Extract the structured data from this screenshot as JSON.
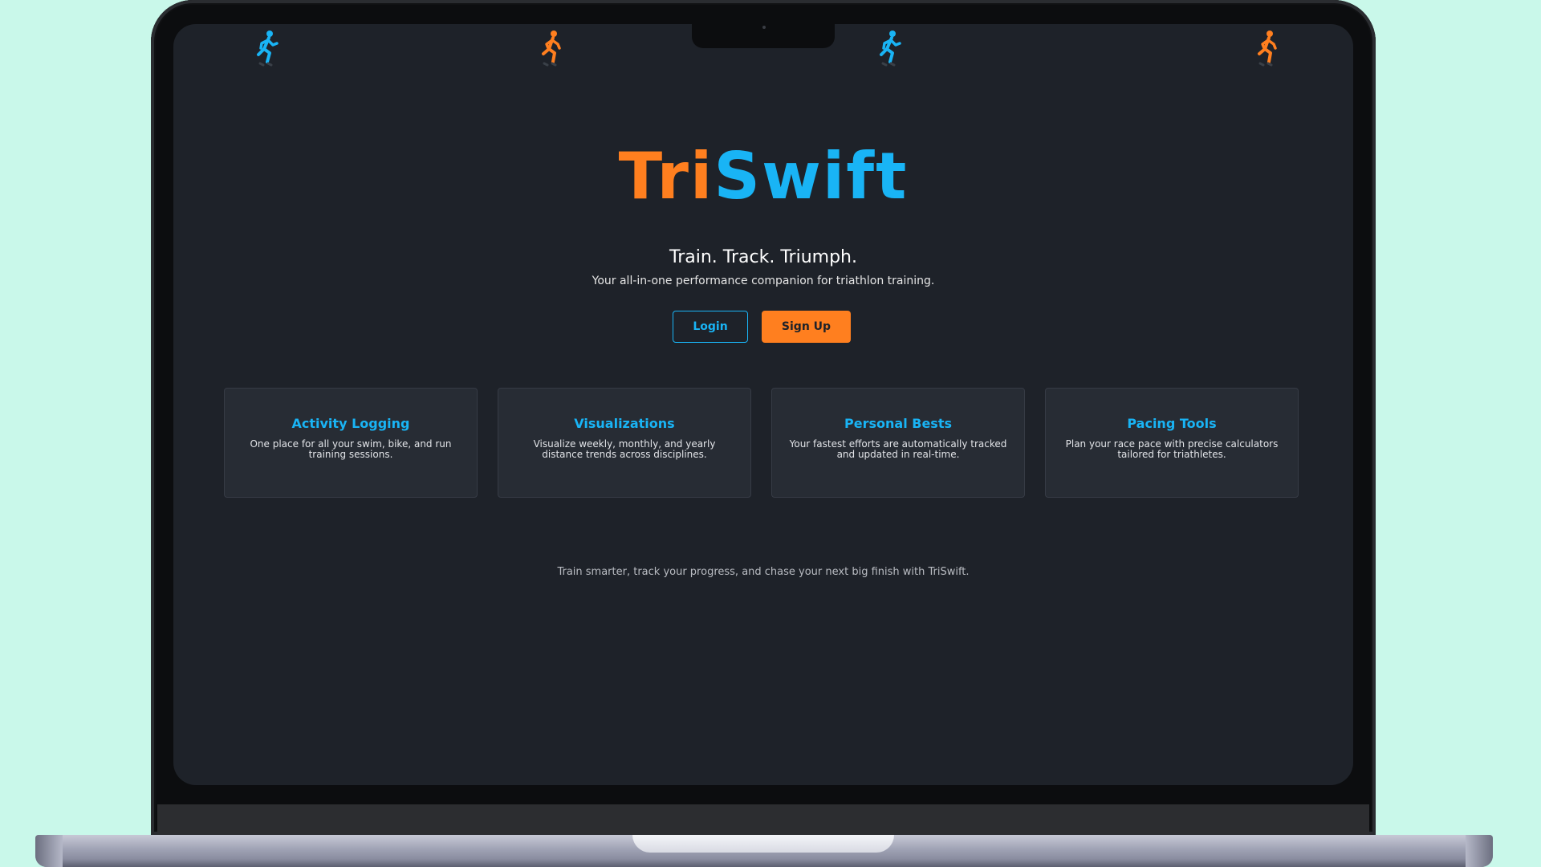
{
  "app": {
    "logo_part1": "Tri",
    "logo_part2": "Swift",
    "tagline": "Train. Track. Triumph.",
    "subtitle": "Your all-in-one performance companion for triathlon training."
  },
  "auth": {
    "login_label": "Login",
    "signup_label": "Sign Up"
  },
  "features": [
    {
      "title": "Activity Logging",
      "description": "One place for all your swim, bike, and run training sessions."
    },
    {
      "title": "Visualizations",
      "description": "Visualize weekly, monthly, and yearly distance trends across disciplines."
    },
    {
      "title": "Personal Bests",
      "description": "Your fastest efforts are automatically tracked and updated in real-time."
    },
    {
      "title": "Pacing Tools",
      "description": "Plan your race pace with precise calculators tailored for triathletes."
    }
  ],
  "footer": {
    "text": "Train smarter, track your progress, and chase your next big finish with TriSwift."
  },
  "icons": {
    "runner_blue": "runner-icon",
    "runner_orange": "runner-icon"
  },
  "colors": {
    "accent_blue": "#19b4f5",
    "accent_orange": "#ff7f1f",
    "background": "#1e2229",
    "card": "#272c34"
  }
}
